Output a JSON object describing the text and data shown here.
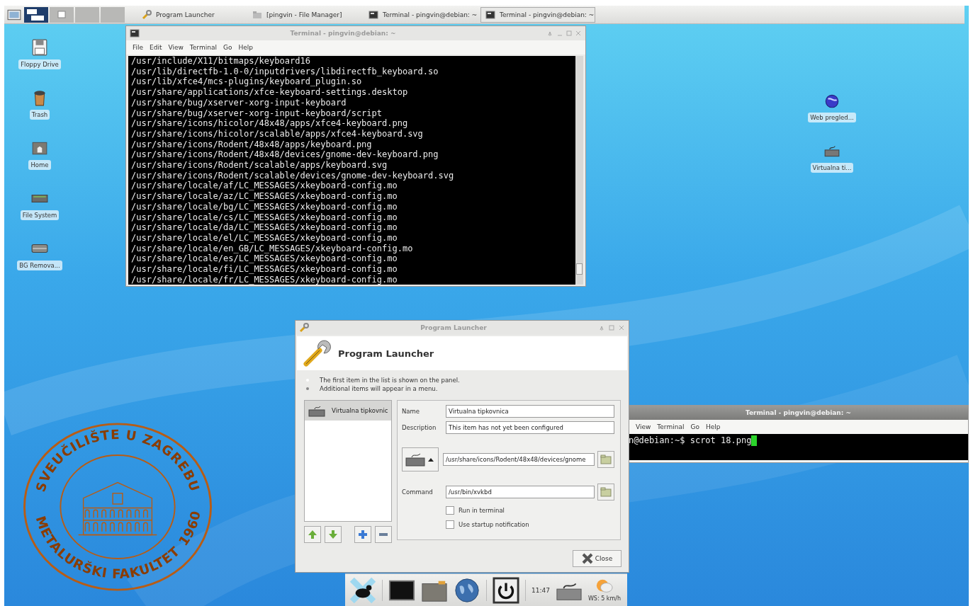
{
  "taskbar": {
    "workspaces": [
      {
        "selected": true
      },
      {
        "selected": false
      },
      {
        "selected": false
      },
      {
        "selected": false
      }
    ],
    "tasks": [
      {
        "title": "Program Launcher",
        "kind": "wrench",
        "selected": false
      },
      {
        "title": "[pingvin - File Manager]",
        "kind": "folder",
        "selected": false
      },
      {
        "title": "Terminal - pingvin@debian: ~",
        "kind": "terminal",
        "selected": false
      },
      {
        "title": "Terminal - pingvin@debian: ~",
        "kind": "terminal",
        "selected": true
      }
    ]
  },
  "desktop_icons_left": [
    {
      "label": "Floppy Drive",
      "kind": "floppy"
    },
    {
      "label": "Trash",
      "kind": "trash"
    },
    {
      "label": "Home",
      "kind": "home"
    },
    {
      "label": "File System",
      "kind": "drive"
    },
    {
      "label": "BG Remova...",
      "kind": "removable"
    }
  ],
  "desktop_icons_right": [
    {
      "label": "Web pregled...",
      "kind": "globe"
    },
    {
      "label": "Virtualna  ti...",
      "kind": "keyboard"
    }
  ],
  "wallpaper_logo": {
    "top_text": "SVEUČILIŠTE U ZAGREBU",
    "bottom_text": "METALURŠKI FAKULTET",
    "year": "1960"
  },
  "terminal_window": {
    "title": "Terminal - pingvin@debian: ~",
    "menu": [
      "File",
      "Edit",
      "View",
      "Terminal",
      "Go",
      "Help"
    ],
    "lines": [
      "/usr/include/X11/bitmaps/keyboard16",
      "/usr/lib/directfb-1.0-0/inputdrivers/libdirectfb_keyboard.so",
      "/usr/lib/xfce4/mcs-plugins/keyboard_plugin.so",
      "/usr/share/applications/xfce-keyboard-settings.desktop",
      "/usr/share/bug/xserver-xorg-input-keyboard",
      "/usr/share/bug/xserver-xorg-input-keyboard/script",
      "/usr/share/icons/hicolor/48x48/apps/xfce4-keyboard.png",
      "/usr/share/icons/hicolor/scalable/apps/xfce4-keyboard.svg",
      "/usr/share/icons/Rodent/48x48/apps/keyboard.png",
      "/usr/share/icons/Rodent/48x48/devices/gnome-dev-keyboard.png",
      "/usr/share/icons/Rodent/scalable/apps/keyboard.svg",
      "/usr/share/icons/Rodent/scalable/devices/gnome-dev-keyboard.svg",
      "/usr/share/locale/af/LC_MESSAGES/xkeyboard-config.mo",
      "/usr/share/locale/az/LC_MESSAGES/xkeyboard-config.mo",
      "/usr/share/locale/bg/LC_MESSAGES/xkeyboard-config.mo",
      "/usr/share/locale/cs/LC_MESSAGES/xkeyboard-config.mo",
      "/usr/share/locale/da/LC_MESSAGES/xkeyboard-config.mo",
      "/usr/share/locale/el/LC_MESSAGES/xkeyboard-config.mo",
      "/usr/share/locale/en_GB/LC_MESSAGES/xkeyboard-config.mo",
      "/usr/share/locale/es/LC_MESSAGES/xkeyboard-config.mo",
      "/usr/share/locale/fi/LC_MESSAGES/xkeyboard-config.mo",
      "/usr/share/locale/fr/LC_MESSAGES/xkeyboard-config.mo"
    ]
  },
  "launcher_window": {
    "title": "Program Launcher",
    "heading": "Program Launcher",
    "info": "The first item in the list is shown on the panel. Additional items will appear in a menu.",
    "items": [
      {
        "label": "Virtualna tipkovnic",
        "selected": true
      }
    ],
    "name_label": "Name",
    "name": "Virtualna tipkovnica",
    "description_label": "Description",
    "description": "This item has not yet been configured",
    "icon_path": "/usr/share/icons/Rodent/48x48/devices/gnome",
    "command_label": "Command",
    "command": "/usr/bin/xvkbd",
    "options": [
      {
        "label": "Run in terminal",
        "checked": false
      },
      {
        "label": "Use startup notification",
        "checked": false
      }
    ],
    "close_label": "Close"
  },
  "terminal_window_2": {
    "title": "Terminal - pingvin@debian: ~",
    "menu": [
      "View",
      "Terminal",
      "Go",
      "Help"
    ],
    "line": "n@debian:~$ scrot 18.png"
  },
  "bottom_panel": {
    "clock": "11:47",
    "weather": "WS: 5 km/h"
  }
}
